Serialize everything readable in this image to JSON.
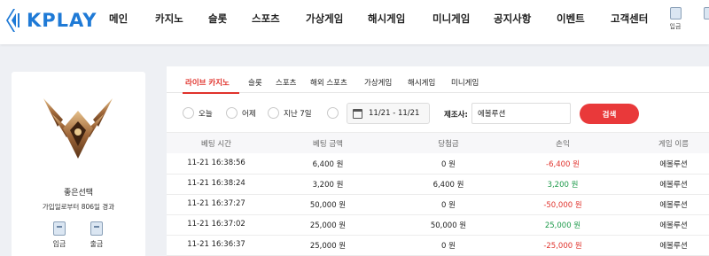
{
  "brand": {
    "logo_text": "KPLAY",
    "accent": "#1f7ad6",
    "highlight": "#e0322c"
  },
  "nav": {
    "items": [
      "메인",
      "카지노",
      "슬롯",
      "스포츠",
      "가상게임",
      "해시게임",
      "미니게임",
      "공지사항",
      "이벤트",
      "고객센터"
    ],
    "login_label": "입금"
  },
  "profile": {
    "nickname": "좋은선택",
    "joined_text": "가입일로부터 806일 경과",
    "deposit_label": "입금",
    "withdraw_label": "출금"
  },
  "tabs": [
    "라이브 카지노",
    "슬롯",
    "스포츠",
    "해외 스포츠",
    "가상게임",
    "해시게임",
    "미니게임"
  ],
  "active_tab": "라이브 카지노",
  "filter": {
    "periods": [
      "오늘",
      "어제",
      "지난 7일"
    ],
    "date_range": "11/21 - 11/21",
    "maker_label": "제조사:",
    "maker_value": "에볼루션",
    "search_label": "검색"
  },
  "table": {
    "headers": [
      "베팅 시간",
      "베팅 금액",
      "당첨금",
      "손익",
      "게임 이름"
    ],
    "rows": [
      {
        "time": "11-21 16:38:56",
        "bet": "6,400 원",
        "win": "0 원",
        "profit": "-6,400 원",
        "profit_sign": "neg",
        "game": "에볼루션"
      },
      {
        "time": "11-21 16:38:24",
        "bet": "3,200 원",
        "win": "6,400 원",
        "profit": "3,200 원",
        "profit_sign": "pos",
        "game": "에볼루션"
      },
      {
        "time": "11-21 16:37:27",
        "bet": "50,000 원",
        "win": "0 원",
        "profit": "-50,000 원",
        "profit_sign": "neg",
        "game": "에볼루션"
      },
      {
        "time": "11-21 16:37:02",
        "bet": "25,000 원",
        "win": "50,000 원",
        "profit": "25,000 원",
        "profit_sign": "pos",
        "game": "에볼루션"
      },
      {
        "time": "11-21 16:36:37",
        "bet": "25,000 원",
        "win": "0 원",
        "profit": "-25,000 원",
        "profit_sign": "neg",
        "game": "에볼루션"
      }
    ]
  }
}
